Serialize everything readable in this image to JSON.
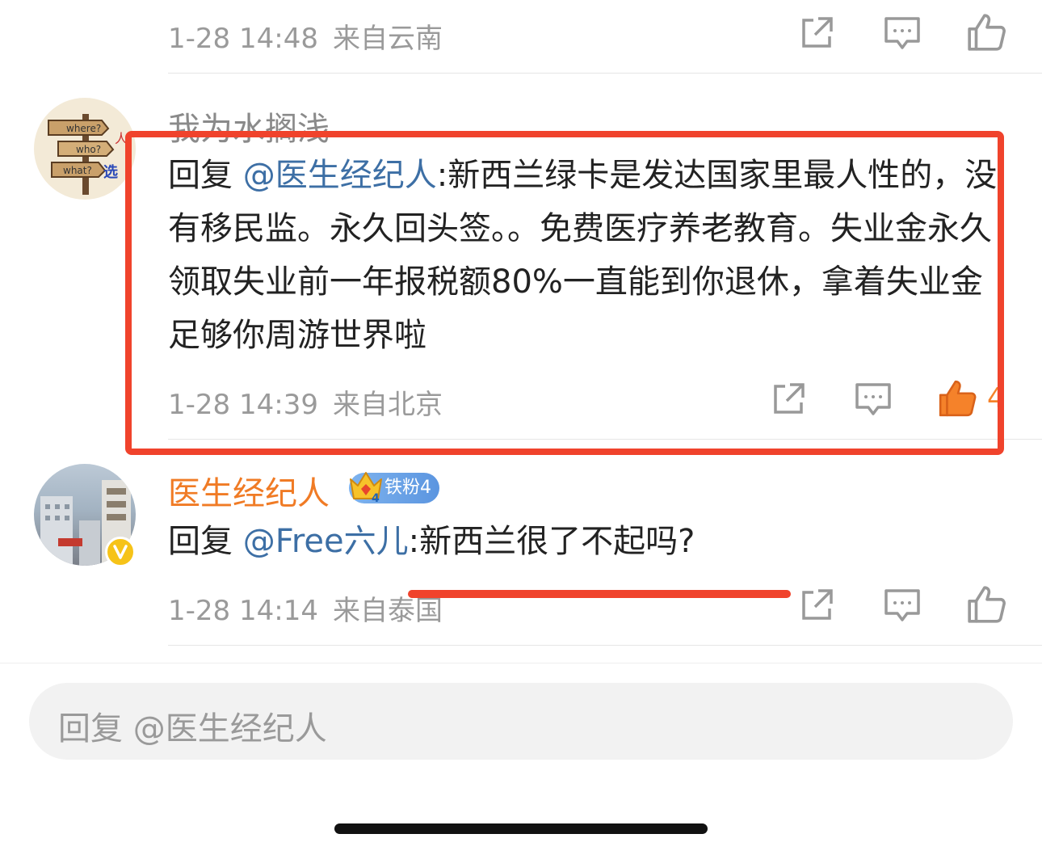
{
  "comments": [
    {
      "time": "1-28 14:48",
      "location": "来自云南"
    },
    {
      "username": "我为水搁浅",
      "reply_prefix": "回复",
      "mention": "@医生经纪人",
      "text": ":新西兰绿卡是发达国家里最人性的，没有移民监。永久回头签。。免费医疗养老教育。失业金永久领取失业前一年报税额80%一直能到你退休，拿着失业金足够你周游世界啦",
      "time": "1-28 14:39",
      "location": "来自北京",
      "like_count_partial": "4",
      "liked": true
    },
    {
      "username": "医生经纪人",
      "fan_badge": "铁粉4",
      "verified": true,
      "reply_prefix": "回复",
      "mention": "@Free六儿",
      "text": ":新西兰很了不起吗?",
      "time": "1-28 14:14",
      "location": "来自泰国"
    }
  ],
  "reply_input": {
    "placeholder": "回复 @医生经纪人"
  },
  "avatar1_sign_words": [
    "where?",
    "who?",
    "what?"
  ],
  "colors": {
    "accent_red": "#f0432c",
    "mention_blue": "#3d6fa5",
    "username_orange": "#f07b25",
    "like_orange": "#f5822a",
    "meta_gray": "#9a9a9a"
  },
  "icons": [
    "share-icon",
    "comment-icon",
    "like-icon",
    "verified-icon",
    "crown-icon"
  ]
}
